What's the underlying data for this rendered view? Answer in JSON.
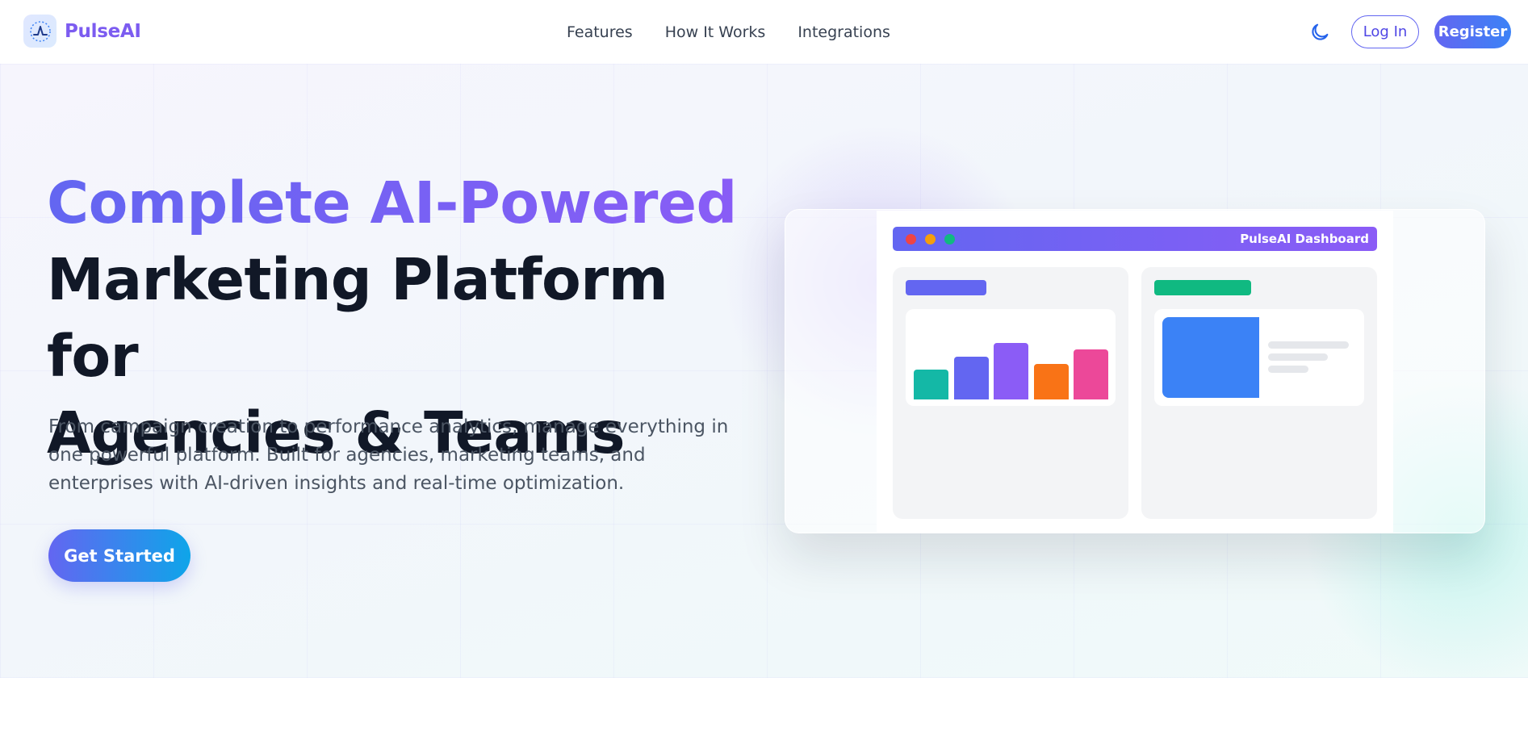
{
  "brand": {
    "name": "PulseAI"
  },
  "nav": {
    "links": [
      "Features",
      "How It Works",
      "Integrations"
    ],
    "login_label": "Log In",
    "register_label": "Register"
  },
  "hero": {
    "headline_accent": "Complete AI-Powered",
    "headline_line2": "Marketing Platform for",
    "headline_line3": "Agencies & Teams",
    "subtext": "From campaign creation to performance analytics, manage everything in one powerful platform. Built for agencies, marketing teams, and enterprises with AI-driven insights and real-time optimization.",
    "cta_label": "Get Started"
  },
  "mockup": {
    "title": "PulseAI Dashboard",
    "window_dots": [
      "#ef4444",
      "#f59e0b",
      "#10b981"
    ],
    "left_card_accent": "#6366f1",
    "right_card_accent": "#10b981",
    "bar_colors": [
      "#14b8a6",
      "#6366f1",
      "#8b5cf6",
      "#f97316",
      "#ec4899"
    ],
    "bar_levels": [
      0.42,
      0.6,
      0.8,
      0.5,
      0.7
    ]
  },
  "colors": {
    "brand": "#7c5cf0",
    "primary": "#6366f1",
    "accent_blue": "#3b82f6"
  }
}
